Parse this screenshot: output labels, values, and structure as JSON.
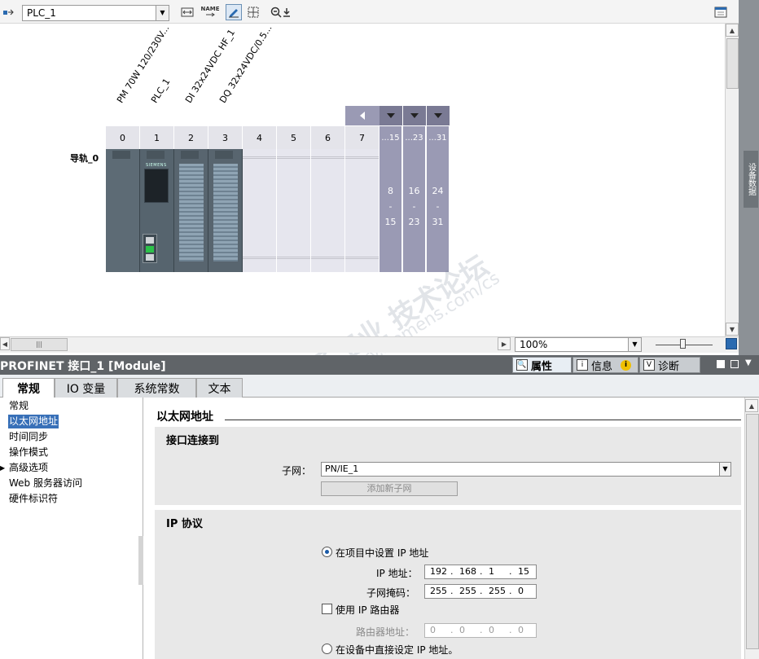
{
  "toolbar": {
    "device_select": "PLC_1",
    "zoom": "100%"
  },
  "canvas": {
    "module_labels": [
      "PM 70W 120/230V...",
      "PLC_1",
      "DI 32x24VDC HF_1",
      "DQ 32x24VDC/0.5..."
    ],
    "rail_label": "导轨_0",
    "slots": [
      "0",
      "1",
      "2",
      "3",
      "4",
      "5",
      "6",
      "7"
    ],
    "ext_slots": [
      "...15",
      "...23",
      "...31"
    ],
    "ext_ranges": [
      {
        "from": "8",
        "dash": "-",
        "to": "15"
      },
      {
        "from": "16",
        "dash": "-",
        "to": "23"
      },
      {
        "from": "24",
        "dash": "-",
        "to": "31"
      }
    ],
    "cpu_logo": "SIEMENS",
    "side_tab": "设备数据",
    "hscroll_grip": "|||"
  },
  "watermark": {
    "line1": "西门子工业 技术论坛",
    "line2": "support.industry.siemens.com/cs"
  },
  "panel": {
    "title": "PROFINET 接口_1 [Module]",
    "tab_properties": "属性",
    "tab_info": "信息",
    "tab_diag": "诊断",
    "subtabs": [
      "常规",
      "IO 变量",
      "系统常数",
      "文本"
    ],
    "nav": [
      "常规",
      "以太网地址",
      "时间同步",
      "操作模式",
      "高级选项",
      "Web 服务器访问",
      "硬件标识符"
    ],
    "section_title": "以太网地址",
    "interface_section": "接口连接到",
    "subnet_label": "子网：",
    "subnet_value": "PN/IE_1",
    "add_subnet_button": "添加新子网",
    "ip_section": "IP 协议",
    "radio_project": "在项目中设置 IP 地址",
    "ip_label": "IP 地址：",
    "ip": [
      "192",
      "168",
      "1",
      "15"
    ],
    "mask_label": "子网掩码：",
    "mask": [
      "255",
      "255",
      "255",
      "0"
    ],
    "use_router": "使用 IP 路由器",
    "router_label": "路由器地址：",
    "router": [
      "0",
      "0",
      "0",
      "0"
    ],
    "radio_device": "在设备中直接设定 IP 地址。"
  }
}
